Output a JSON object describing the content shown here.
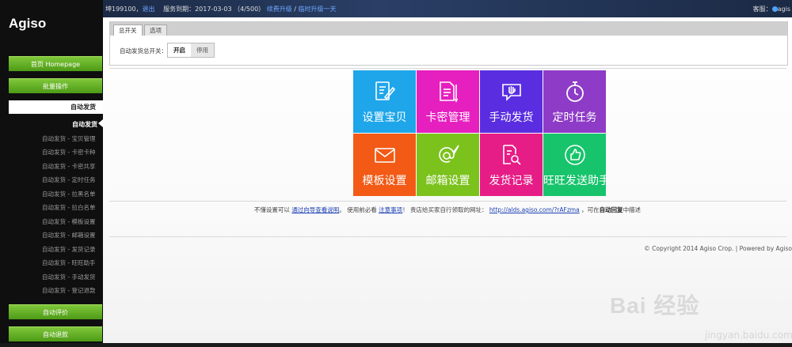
{
  "sidebar": {
    "logo": "Agiso",
    "homepage_label": "首页 Homepage",
    "batch_label": "批量操作",
    "section_auto_ship": "自动发货",
    "active_sub": "自动发货",
    "items": [
      "自动发货 - 宝贝管理",
      "自动发货 - 卡密卡种",
      "自动发货 - 卡密共享",
      "自动发货 - 定时任务",
      "自动发货 - 拉黑名单",
      "自动发货 - 拉白名单",
      "自动发货 - 模板设置",
      "自动发货 - 邮箱设置",
      "自动发货 - 发货记录",
      "自动发货 - 旺旺助手",
      "自动发货 - 手动发货",
      "自动发货 - 登记退款"
    ],
    "auto_review_label": "自动评价",
    "auto_refund_label": "自动退款"
  },
  "topbar": {
    "user": "坤199100",
    "sep": "，",
    "logout": "退出",
    "service": "服务到期：2017-03-03 （4/500）",
    "renew": "续费升级",
    "slash": " / ",
    "temp_upgrade": "临时升级一天",
    "support": "客服：",
    "support_name": "agis"
  },
  "panel": {
    "tab_main": "总开关",
    "tab_options": "选项",
    "switch_label": "自动发货总开关：",
    "on_label": "开启",
    "off_label": "停用"
  },
  "tiles": [
    {
      "label": "设置宝贝",
      "color": "#1fa6ea",
      "icon": "edit-doc-icon"
    },
    {
      "label": "卡密管理",
      "color": "#e61fbf",
      "icon": "card-doc-icon"
    },
    {
      "label": "手动发货",
      "color": "#5a2ee0",
      "icon": "hand-message-icon"
    },
    {
      "label": "定时任务",
      "color": "#8e3bc7",
      "icon": "stopwatch-icon"
    },
    {
      "label": "模板设置",
      "color": "#f25a16",
      "icon": "envelope-icon"
    },
    {
      "label": "邮箱设置",
      "color": "#7cc21d",
      "icon": "at-feather-icon"
    },
    {
      "label": "发货记录",
      "color": "#e61d86",
      "icon": "record-search-icon"
    },
    {
      "label": "旺旺发送助手",
      "color": "#17c46c",
      "icon": "thumbs-up-icon"
    }
  ],
  "tip": {
    "prefix": "不懂设置可以 ",
    "guide_link": "通过向导查看说明",
    "mid": "。 使用前必看 ",
    "notice_link": "注意事项",
    "claim": "！ 贵店给买家自行领取的网址：",
    "url": "http://alds.agiso.com/?rAFzma",
    "suffix_pre": " ，可在",
    "suffix_bold": "自动回复",
    "suffix_post": "中描述"
  },
  "footer": {
    "copyright": "© Copyright 2014 Agiso Crop. | Powered by Agiso"
  },
  "watermark": {
    "brand": "Bai 经验",
    "url": "jingyan.baidu.com"
  }
}
